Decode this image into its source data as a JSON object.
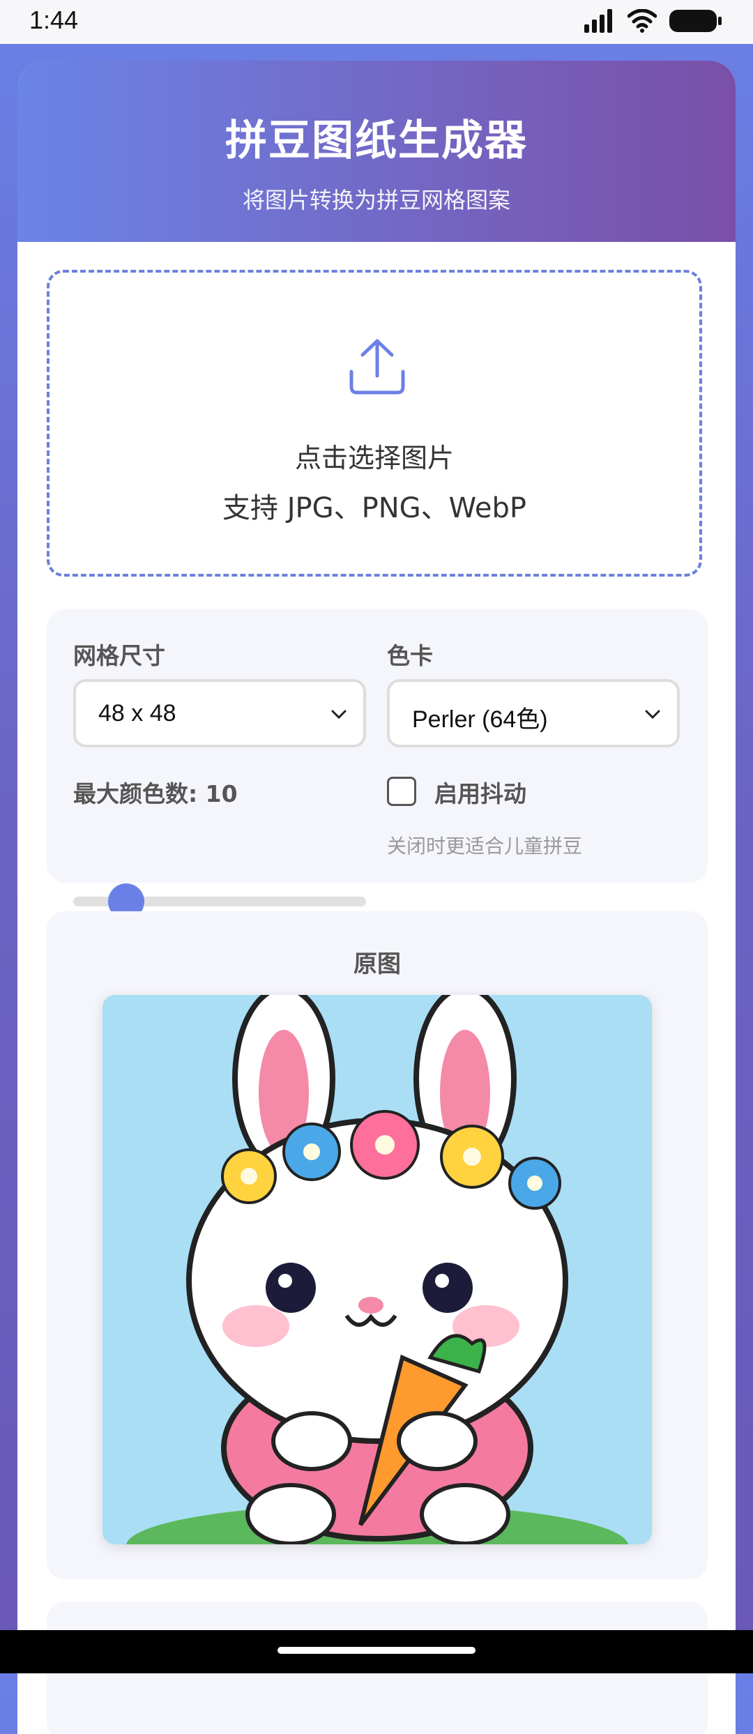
{
  "status_bar": {
    "time": "1:44"
  },
  "header": {
    "title": "拼豆图纸生成器",
    "subtitle": "将图片转换为拼豆网格图案"
  },
  "upload": {
    "line1": "点击选择图片",
    "line2": "支持 JPG、PNG、WebP",
    "icon": "upload-icon"
  },
  "settings": {
    "grid_label": "网格尺寸",
    "grid_value": "48 x 48",
    "palette_label": "色卡",
    "palette_value": "Perler (64色)",
    "max_colors_label": "最大颜色数: 10",
    "max_colors_value": 10,
    "dither_label": "启用抖动",
    "dither_checked": false,
    "dither_hint": "关闭时更适合儿童拼豆"
  },
  "preview": {
    "title": "原图"
  },
  "colors": {
    "accent": "#6b80e6",
    "header_start": "#6b84e6",
    "header_end": "#7a4fa8"
  }
}
